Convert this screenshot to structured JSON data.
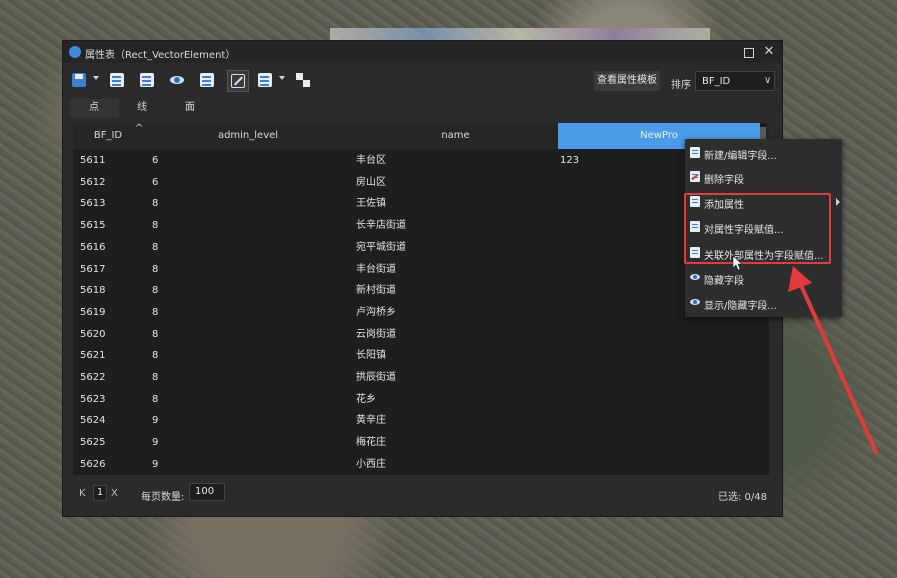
{
  "window": {
    "title": "属性表（Rect_VectorElement）",
    "max_icon": "maximize-icon",
    "close_icon": "close-icon"
  },
  "toolbar": {
    "icons": [
      "save-icon",
      "export-icon",
      "table-icon",
      "eye-icon",
      "field-icon",
      "edit-icon",
      "list-icon",
      "layers-icon"
    ],
    "template_button": "查看属性模板",
    "sort_label": "排序",
    "sort_value": "BF_ID"
  },
  "geometry_tabs": [
    {
      "label": "点",
      "active": true
    },
    {
      "label": "线",
      "active": false
    },
    {
      "label": "面",
      "active": false
    }
  ],
  "table": {
    "columns": [
      "BF_ID",
      "admin_level",
      "name",
      "NewPro"
    ],
    "sort_indicator": "^",
    "rows": [
      {
        "id": "5611",
        "level": "6",
        "name": "丰台区",
        "newpro": "123"
      },
      {
        "id": "5612",
        "level": "6",
        "name": "房山区",
        "newpro": ""
      },
      {
        "id": "5613",
        "level": "8",
        "name": "王佐镇",
        "newpro": ""
      },
      {
        "id": "5615",
        "level": "8",
        "name": "长辛店街道",
        "newpro": ""
      },
      {
        "id": "5616",
        "level": "8",
        "name": "宛平城街道",
        "newpro": ""
      },
      {
        "id": "5617",
        "level": "8",
        "name": "丰台街道",
        "newpro": ""
      },
      {
        "id": "5618",
        "level": "8",
        "name": "新村街道",
        "newpro": ""
      },
      {
        "id": "5619",
        "level": "8",
        "name": "卢沟桥乡",
        "newpro": ""
      },
      {
        "id": "5620",
        "level": "8",
        "name": "云岗街道",
        "newpro": ""
      },
      {
        "id": "5621",
        "level": "8",
        "name": "长阳镇",
        "newpro": ""
      },
      {
        "id": "5622",
        "level": "8",
        "name": "拱辰街道",
        "newpro": ""
      },
      {
        "id": "5623",
        "level": "8",
        "name": "花乡",
        "newpro": ""
      },
      {
        "id": "5624",
        "level": "9",
        "name": "黄辛庄",
        "newpro": ""
      },
      {
        "id": "5625",
        "level": "9",
        "name": "梅花庄",
        "newpro": ""
      },
      {
        "id": "5626",
        "level": "9",
        "name": "小西庄",
        "newpro": ""
      }
    ]
  },
  "footer": {
    "first_icon": "K",
    "page": "1",
    "last_icon": "X",
    "per_page_label": "每页数量:",
    "per_page": "100",
    "selected": "已选: 0/48"
  },
  "context_menu": {
    "items": [
      {
        "label": "新建/编辑字段...",
        "icon": "field-edit-icon"
      },
      {
        "label": "删除字段",
        "icon": "delete-field-icon"
      },
      {
        "label": "添加属性",
        "icon": "add-attribute-icon"
      },
      {
        "label": "对属性字段赋值...",
        "icon": "assign-value-icon"
      },
      {
        "label": "关联外部属性为字段赋值...",
        "icon": "link-external-icon"
      },
      {
        "label": "隐藏字段",
        "icon": "eye-icon"
      },
      {
        "label": "显示/隐藏字段...",
        "icon": "eye-icon"
      }
    ]
  },
  "colors": {
    "accent": "#4a9be8",
    "annotation": "#e23b3b"
  }
}
